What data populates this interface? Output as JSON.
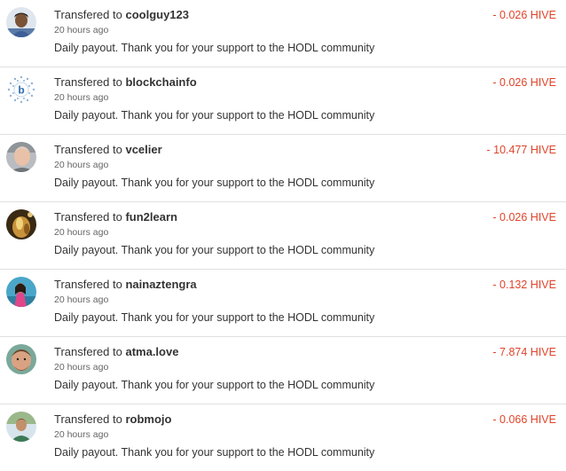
{
  "colors": {
    "amount": "#e0442b",
    "divider": "#e0e0e0"
  },
  "transfers": [
    {
      "prefix": "Transfered to",
      "user": "coolguy123",
      "time": "20 hours ago",
      "memo": "Daily payout. Thank you for your support to the HODL community",
      "amount": "- 0.026 HIVE",
      "avatar_icon": "person-avatar-icon"
    },
    {
      "prefix": "Transfered to",
      "user": "blockchainfo",
      "time": "20 hours ago",
      "memo": "Daily payout. Thank you for your support to the HODL community",
      "amount": "- 0.026 HIVE",
      "avatar_icon": "blockchain-logo-icon"
    },
    {
      "prefix": "Transfered to",
      "user": "vcelier",
      "time": "20 hours ago",
      "memo": "Daily payout. Thank you for your support to the HODL community",
      "amount": "- 10.477 HIVE",
      "avatar_icon": "person-avatar-icon"
    },
    {
      "prefix": "Transfered to",
      "user": "fun2learn",
      "time": "20 hours ago",
      "memo": "Daily payout. Thank you for your support to the HODL community",
      "amount": "- 0.026 HIVE",
      "avatar_icon": "photo-avatar-icon"
    },
    {
      "prefix": "Transfered to",
      "user": "nainaztengra",
      "time": "20 hours ago",
      "memo": "Daily payout. Thank you for your support to the HODL community",
      "amount": "- 0.132 HIVE",
      "avatar_icon": "person-avatar-icon"
    },
    {
      "prefix": "Transfered to",
      "user": "atma.love",
      "time": "20 hours ago",
      "memo": "Daily payout. Thank you for your support to the HODL community",
      "amount": "- 7.874 HIVE",
      "avatar_icon": "person-avatar-icon"
    },
    {
      "prefix": "Transfered to",
      "user": "robmojo",
      "time": "20 hours ago",
      "memo": "Daily payout. Thank you for your support to the HODL community",
      "amount": "- 0.066 HIVE",
      "avatar_icon": "person-avatar-icon"
    }
  ]
}
